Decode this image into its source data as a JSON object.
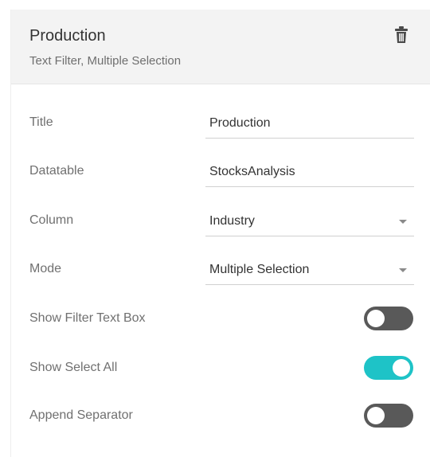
{
  "header": {
    "title": "Production",
    "subtitle": "Text Filter, Multiple Selection"
  },
  "icons": {
    "delete": "trash-icon",
    "dropdown": "chevron-down-icon"
  },
  "fields": {
    "title": {
      "label": "Title",
      "value": "Production"
    },
    "datatable": {
      "label": "Datatable",
      "value": "StocksAnalysis"
    },
    "column": {
      "label": "Column",
      "value": "Industry"
    },
    "mode": {
      "label": "Mode",
      "value": "Multiple Selection"
    }
  },
  "toggles": {
    "show_filter_text_box": {
      "label": "Show Filter Text Box",
      "on": false
    },
    "show_select_all": {
      "label": "Show Select All",
      "on": true
    },
    "append_separator": {
      "label": "Append Separator",
      "on": false
    }
  },
  "colors": {
    "toggle_on": "#1ec3c7",
    "toggle_off": "#595959",
    "header_bg": "#f3f3f3"
  }
}
